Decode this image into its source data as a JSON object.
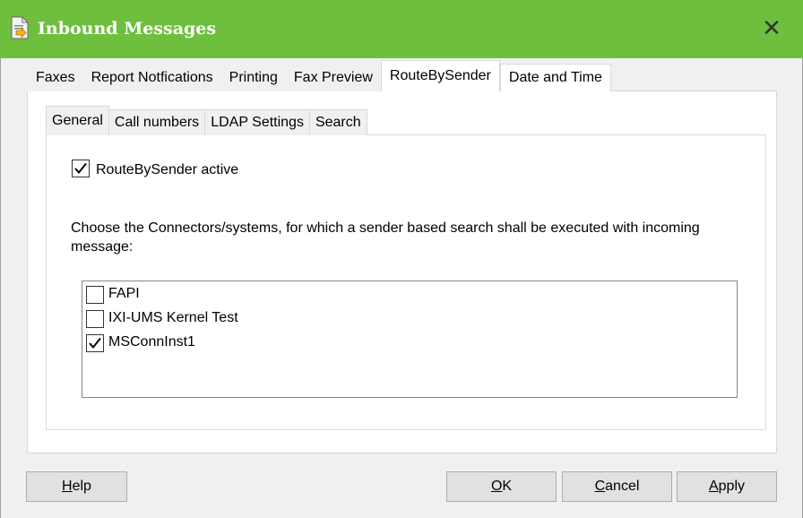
{
  "window": {
    "title": "Inbound Messages",
    "close_glyph": "✕",
    "accent": "#6fbf3f"
  },
  "outer_tabs": [
    {
      "label": "Faxes"
    },
    {
      "label": "Report Notfications"
    },
    {
      "label": "Printing"
    },
    {
      "label": "Fax Preview"
    },
    {
      "label": "RouteBySender",
      "active": true
    },
    {
      "label": "Date and Time"
    }
  ],
  "inner_tabs": [
    {
      "label": "General",
      "active": true
    },
    {
      "label": "Call numbers"
    },
    {
      "label": "LDAP Settings"
    },
    {
      "label": "Search"
    }
  ],
  "general": {
    "route_active_label": "RouteBySender active",
    "route_active_checked": true,
    "description": "Choose the Connectors/systems, for which a sender based search shall be executed with incoming message:",
    "connectors": [
      {
        "label": "FAPI",
        "checked": false
      },
      {
        "label": "IXI-UMS Kernel Test",
        "checked": false
      },
      {
        "label": "MSConnInst1",
        "checked": true
      }
    ]
  },
  "buttons": {
    "help": {
      "first": "H",
      "rest": "elp"
    },
    "ok": {
      "first": "O",
      "rest": "K"
    },
    "cancel": {
      "first": "C",
      "rest": "ancel"
    },
    "apply": {
      "first": "A",
      "rest": "pply"
    }
  }
}
